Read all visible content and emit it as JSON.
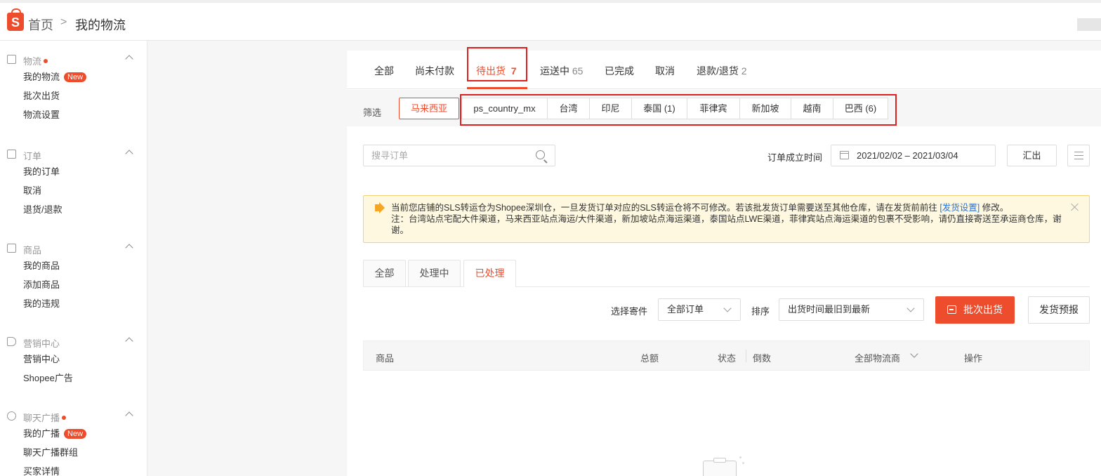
{
  "header": {
    "home": "首页",
    "separator": ">",
    "current": "我的物流"
  },
  "sidebar": {
    "sections": [
      {
        "title": "物流",
        "dot": true,
        "items": [
          {
            "label": "我的物流",
            "badge": "New"
          },
          {
            "label": "批次出货"
          },
          {
            "label": "物流设置"
          }
        ]
      },
      {
        "title": "订单",
        "dot": false,
        "items": [
          {
            "label": "我的订单"
          },
          {
            "label": "取消"
          },
          {
            "label": "退货/退款"
          }
        ]
      },
      {
        "title": "商品",
        "dot": false,
        "items": [
          {
            "label": "我的商品"
          },
          {
            "label": "添加商品"
          },
          {
            "label": "我的违规"
          }
        ]
      },
      {
        "title": "营销中心",
        "dot": false,
        "items": [
          {
            "label": "营销中心"
          },
          {
            "label": "Shopee广告"
          }
        ]
      },
      {
        "title": "聊天广播",
        "dot": true,
        "items": [
          {
            "label": "我的广播",
            "badge": "New"
          },
          {
            "label": "聊天广播群组"
          },
          {
            "label": "买家详情"
          }
        ]
      }
    ]
  },
  "tabs": [
    {
      "label": "全部",
      "count": ""
    },
    {
      "label": "尚未付款",
      "count": ""
    },
    {
      "label": "待出货",
      "count": "7"
    },
    {
      "label": "运送中",
      "count": "65"
    },
    {
      "label": "已完成",
      "count": ""
    },
    {
      "label": "取消",
      "count": ""
    },
    {
      "label": "退款/退货",
      "count": "2"
    }
  ],
  "filter": {
    "label": "筛选",
    "chips": [
      "马来西亚",
      "ps_country_mx",
      "台湾",
      "印尼",
      "泰国 (1)",
      "菲律宾",
      "新加坡",
      "越南",
      "巴西 (6)"
    ]
  },
  "search": {
    "placeholder": "搜寻订单"
  },
  "date_filter": {
    "label": "订单成立时间",
    "range": "2021/02/02 – 2021/03/04",
    "export_label": "汇出"
  },
  "notice": {
    "text_before_link": "当前您店铺的SLS转运仓为Shopee深圳仓，一旦发货订单对应的SLS转运仓将不可修改。若该批发货订单需要送至其他仓库，请在发货前前往 ",
    "link": "[发货设置]",
    "text_after_link": " 修改。",
    "note": "注：台湾站点宅配大件渠道，马来西亚站点海运/大件渠道，新加坡站点海运渠道，泰国站点LWE渠道，菲律宾站点海运渠道的包裹不受影响，请仍直接寄送至承运商仓库，谢谢。"
  },
  "subtabs": [
    "全部",
    "处理中",
    "已处理"
  ],
  "controls": {
    "courier_label": "选择寄件",
    "courier_value": "全部订单",
    "sort_label": "排序",
    "sort_value": "出货时间最旧到最新",
    "batch_ship": "批次出货",
    "ship_forecast": "发货预报"
  },
  "table_headers": {
    "product": "商品",
    "total": "总额",
    "status": "状态",
    "countdown": "倒数",
    "carrier": "全部物流商",
    "action": "操作"
  },
  "colors": {
    "accent": "#ee4d2d",
    "highlight_box": "#e01f1f",
    "notice_bg": "#fff8e1",
    "link": "#2673dd"
  }
}
